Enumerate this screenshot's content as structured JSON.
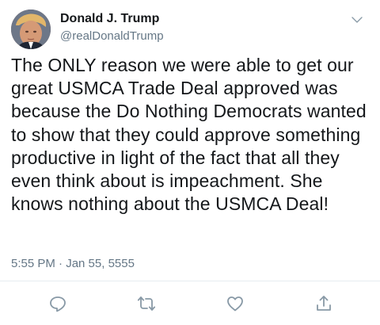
{
  "author": {
    "display_name": "Donald J. Trump",
    "handle": "@realDonaldTrump"
  },
  "tweet": {
    "text": "The ONLY reason we were able to get our great USMCA Trade Deal approved was because the Do Nothing Democrats wanted to show that they could approve something productive in light of the fact that all they even think about is impeachment. She knows nothing about the USMCA Deal!",
    "timestamp": "5:55 PM · Jan 55, 5555"
  },
  "icons": {
    "menu": "chevron-down-icon",
    "reply": "reply-icon",
    "retweet": "retweet-icon",
    "like": "heart-icon",
    "share": "share-icon"
  },
  "colors": {
    "text": "#14171a",
    "secondary": "#657786",
    "icon": "#8899a6",
    "divider": "#e6ecf0"
  }
}
